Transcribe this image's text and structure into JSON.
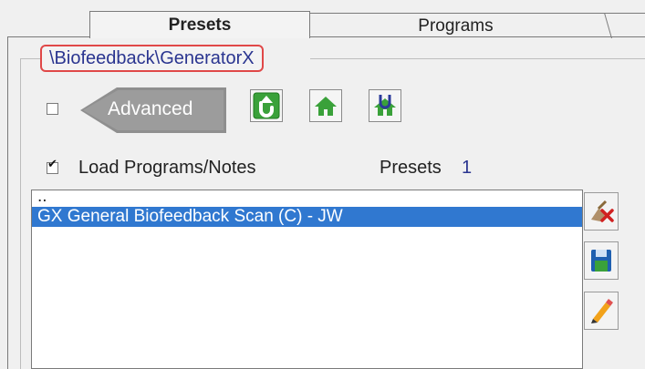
{
  "tabs": [
    {
      "label": "Presets",
      "active": true
    },
    {
      "label": "Programs",
      "active": false
    },
    {
      "label": "",
      "active": false
    }
  ],
  "path": "\\Biofeedback\\GeneratorX",
  "advanced": {
    "label": "Advanced",
    "checked": false
  },
  "toolbar": {
    "icons": [
      "refresh-up-icon",
      "home-icon",
      "user-home-icon"
    ],
    "colors": {
      "green": "#3aa13a",
      "dark_green": "#1f7a1f",
      "blue": "#2a3a9a"
    }
  },
  "load_programs": {
    "label": "Load Programs/Notes",
    "checked": true
  },
  "presets_count": {
    "label": "Presets",
    "value": "1"
  },
  "list": {
    "items": [
      {
        "text": "..",
        "selected": false
      },
      {
        "text": "GX General Biofeedback Scan (C) - JW",
        "selected": true
      }
    ]
  },
  "side_buttons": [
    "delete-icon",
    "save-icon",
    "edit-icon"
  ],
  "colors": {
    "selection": "#3078d0",
    "path_border": "#e04848",
    "path_text": "#2a3590"
  }
}
